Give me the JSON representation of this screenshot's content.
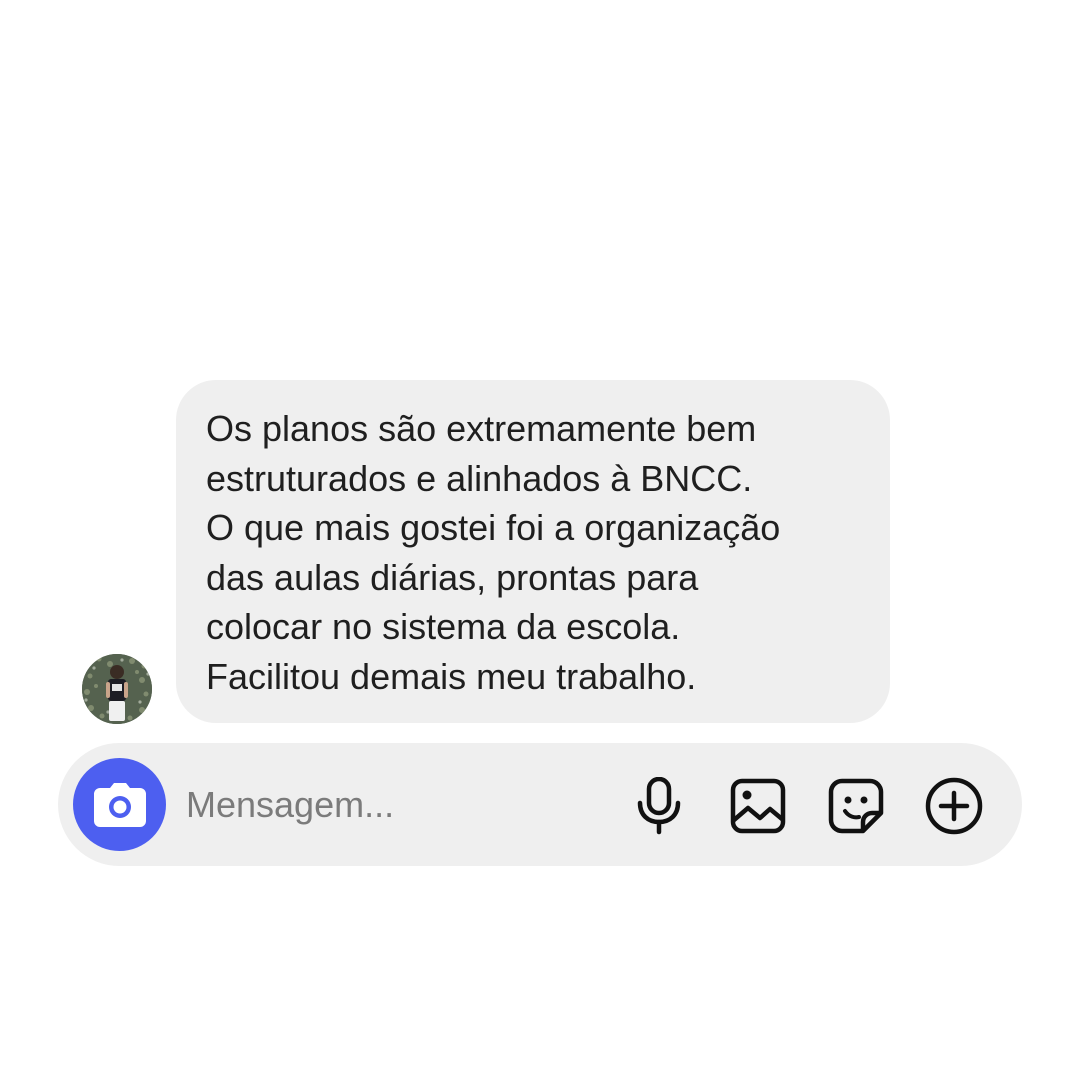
{
  "message": {
    "lines": [
      "Os planos são extremamente bem",
      "estruturados e alinhados à BNCC.",
      "O que mais gostei foi a organização",
      "das aulas diárias, prontas para",
      "colocar no sistema da escola.",
      "Facilitou demais meu trabalho."
    ]
  },
  "composer": {
    "placeholder": "Mensagem...",
    "value": "",
    "icons": {
      "camera": "camera-icon",
      "mic": "microphone-icon",
      "gallery": "image-icon",
      "sticker": "sticker-icon",
      "add": "plus-circle-icon"
    }
  },
  "colors": {
    "background": "#ffffff",
    "bubble": "#efefef",
    "composer": "#efefef",
    "camera_accent": "#4d5ff0",
    "text": "#1f1f1f",
    "placeholder": "#7b7b7b",
    "icon": "#111111"
  }
}
